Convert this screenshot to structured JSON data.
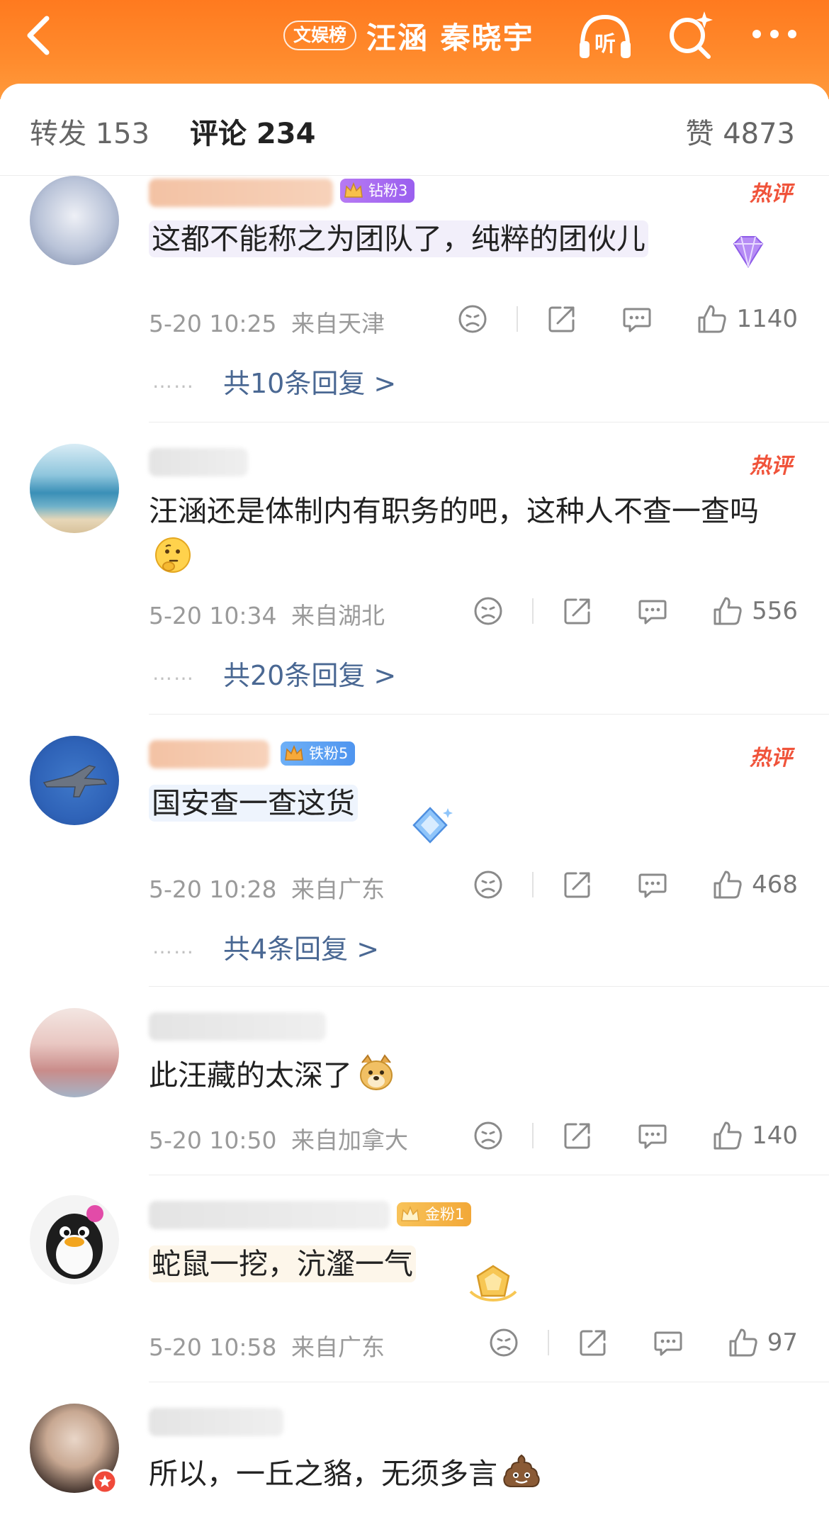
{
  "header": {
    "topic_badge": "文娱榜",
    "title": "汪涵 秦晓宇",
    "listen_label": "听"
  },
  "tabs": {
    "forward": "转发 153",
    "comment": "评论 234",
    "like": "赞 4873"
  },
  "colors": {
    "header_orange": "#ff8227",
    "hot_red": "#f0533a",
    "reply_blue": "#4a6893",
    "diamond_badge": "#a26bf1",
    "iron_badge": "#5aa0f5",
    "gold_badge": "#f5b23c"
  },
  "comments": [
    {
      "fan_badge": "钻粉3",
      "hot_tag": "热评",
      "text": "这都不能称之为团队了，纯粹的团伙儿",
      "time": "5-20 10:25",
      "location": "来自天津",
      "likes": "1140",
      "replies": "共10条回复 >",
      "icons": [
        "dislike-icon",
        "share-icon",
        "comment-icon",
        "like-icon"
      ]
    },
    {
      "hot_tag": "热评",
      "text": "汪涵还是体制内有职务的吧，这种人不查一查吗",
      "emoji": "thinking-emoji",
      "time": "5-20 10:34",
      "location": "来自湖北",
      "likes": "556",
      "replies": "共20条回复 >"
    },
    {
      "fan_badge": "铁粉5",
      "hot_tag": "热评",
      "text": "国安查一查这货",
      "time": "5-20 10:28",
      "location": "来自广东",
      "likes": "468",
      "replies": "共4条回复 >"
    },
    {
      "text": "此汪藏的太深了",
      "emoji": "doge-emoji",
      "time": "5-20 10:50",
      "location": "来自加拿大",
      "likes": "140"
    },
    {
      "fan_badge": "金粉1",
      "text": "蛇鼠一挖，沆瀣一气",
      "time": "5-20 10:58",
      "location": "来自广东",
      "likes": "97"
    },
    {
      "text": "所以，一丘之貉，无须多言",
      "emoji": "poop-emoji"
    }
  ]
}
